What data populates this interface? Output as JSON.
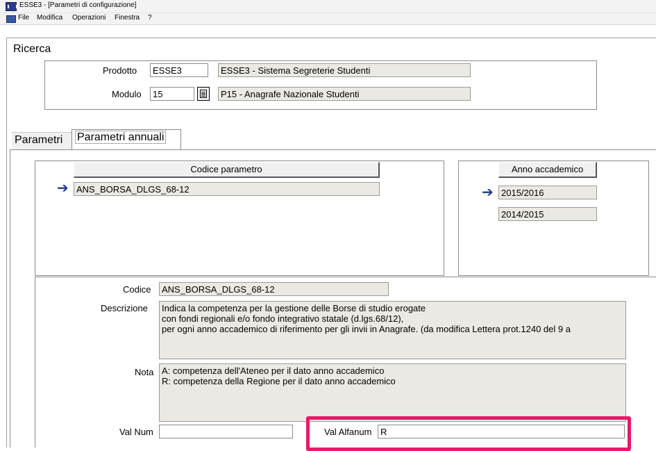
{
  "window": {
    "title": "ESSE3 - [Parametri di configurazione]"
  },
  "menu": {
    "items": [
      "File",
      "Modifica",
      "Operazioni",
      "Finestra",
      "?"
    ]
  },
  "ricerca": {
    "title": "Ricerca",
    "prodotto_label": "Prodotto",
    "prodotto_value": "ESSE3",
    "prodotto_desc": "ESSE3 - Sistema Segreterie Studenti",
    "modulo_label": "Modulo",
    "modulo_value": "15",
    "modulo_desc": "P15 - Anagrafe Nazionale Studenti"
  },
  "tabs": [
    {
      "label": "Parametri",
      "active": false
    },
    {
      "label": "Parametri annuali",
      "active": true
    }
  ],
  "codice_list": {
    "header": "Codice parametro",
    "rows": [
      "ANS_BORSA_DLGS_68-12"
    ]
  },
  "anno_list": {
    "header": "Anno accademico",
    "rows": [
      "2015/2016",
      "2014/2015"
    ]
  },
  "detail": {
    "codice_label": "Codice",
    "codice_value": "ANS_BORSA_DLGS_68-12",
    "descrizione_label": "Descrizione",
    "descrizione_lines": [
      "Indica la competenza per la gestione delle Borse di studio erogate",
      "con fondi regionali e/o fondo integrativo statale (d.lgs.68/12),",
      "per ogni anno accademico di riferimento per gli invii in Anagrafe. (da modifica Lettera prot.1240 del 9 a"
    ],
    "nota_label": "Nota",
    "nota_lines": [
      "A: competenza dell'Ateneo per il dato anno accademico",
      "R: competenza della Regione per il dato anno accademico"
    ],
    "val_num_label": "Val Num",
    "val_num_value": "",
    "val_alfanum_label": "Val Alfanum",
    "val_alfanum_value": "R"
  },
  "colors": {
    "highlight": "#e8196a",
    "readonly_bg": "#ebe9e3",
    "arrow": "#1f3a8a"
  }
}
